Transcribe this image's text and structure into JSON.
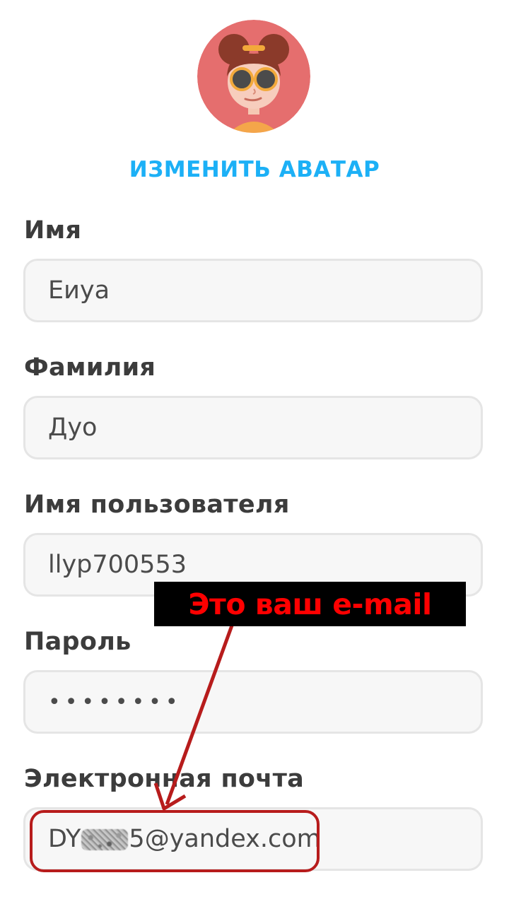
{
  "profile": {
    "change_avatar_label": "ИЗМЕНИТЬ АВАТАР"
  },
  "form": {
    "first_name": {
      "label": "Имя",
      "value": "Еиуа"
    },
    "last_name": {
      "label": "Фамилия",
      "value": "Дуо"
    },
    "username": {
      "label": "Имя пользователя",
      "value": "llyp700553"
    },
    "password": {
      "label": "Пароль",
      "value": "••••••••"
    },
    "email": {
      "label": "Электронная почта",
      "value_prefix": "DY",
      "value_suffix": "5@yandex.com"
    }
  },
  "annotation": {
    "text": "Это ваш e-mail",
    "color": "#ff0000"
  },
  "colors": {
    "accent": "#1cb0f6",
    "annotation_arrow": "#b71c1c"
  }
}
